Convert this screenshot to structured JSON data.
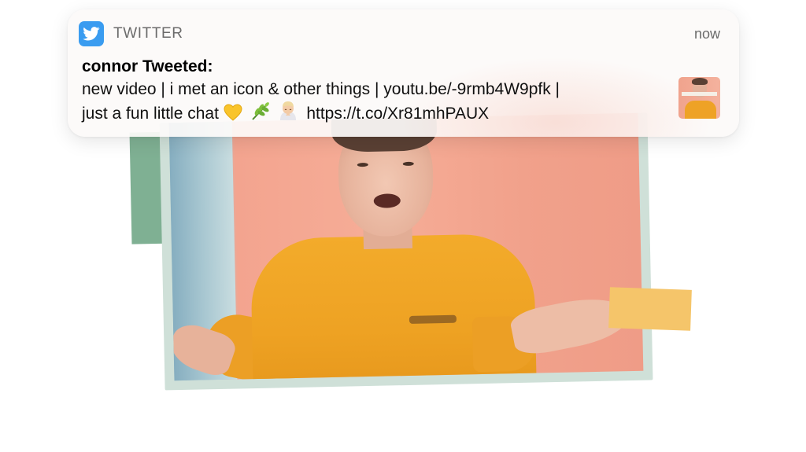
{
  "notification": {
    "app_name": "TWITTER",
    "app_icon": "twitter-bird-icon",
    "timestamp": "now",
    "title": "connor Tweeted:",
    "body_line1": "new video | i met an icon & other things | youtu.be/-9rmb4W9pfk |",
    "body_line2_text": "just a fun little chat",
    "body_line2_link": "https://t.co/Xr81mhPAUX",
    "emojis": [
      "yellow-heart-emoji",
      "herb-emoji",
      "person-bowing-emoji"
    ]
  },
  "colors": {
    "twitter_blue": "#3a9cf0",
    "sweater_yellow": "#f0a326",
    "background_salmon": "#f4a892",
    "frame_mint": "#cfe0d8",
    "block_green": "#74a98a",
    "block_yellow": "#f5c56a"
  }
}
